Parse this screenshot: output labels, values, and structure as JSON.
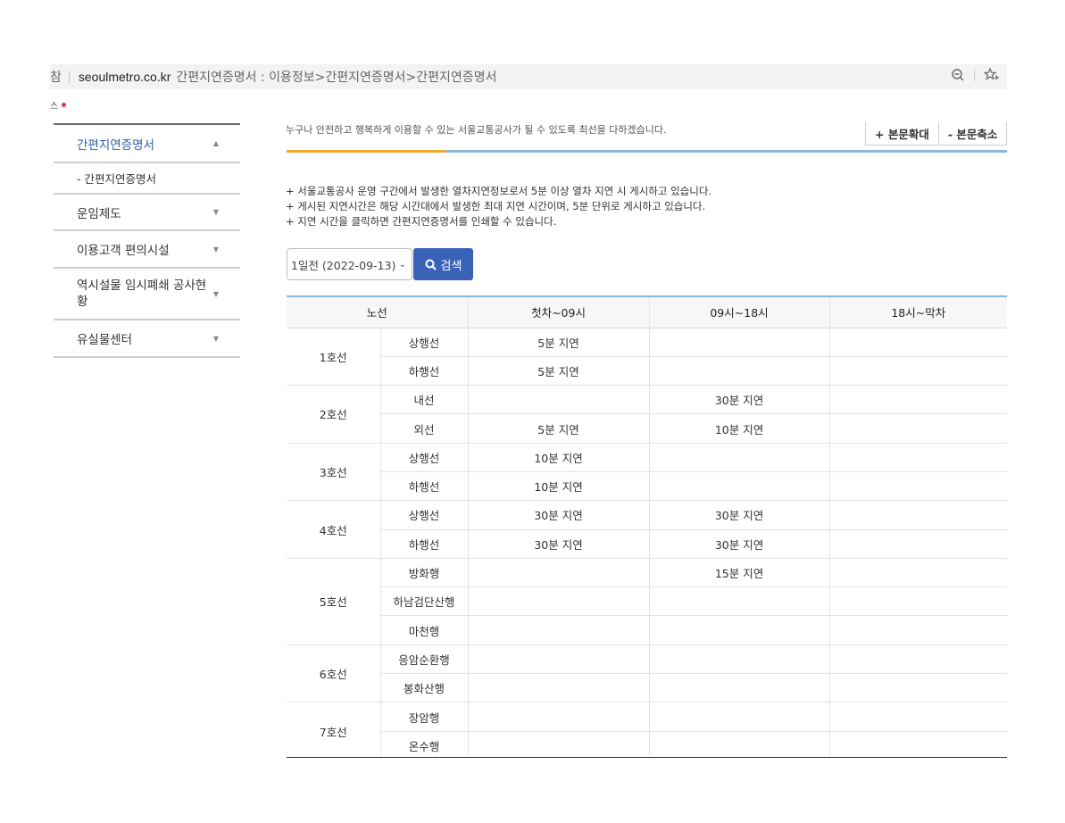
{
  "browser": {
    "left_glyph": "참",
    "domain": "seoulmetro.co.kr",
    "page_title": "간편지연증명서 : 이용정보>간편지연증명서>간편지연증명서",
    "icons": [
      "zoom-out-icon",
      "favorites-star-icon"
    ],
    "bookmark_fragment": "스"
  },
  "sidebar": {
    "active_label": "간편지연증명서",
    "sub_item": "- 간편지연증명서",
    "items": [
      {
        "label": "운임제도"
      },
      {
        "label": "이용고객 편의시설"
      },
      {
        "label": "역시설물 임시폐쇄 공사현황"
      },
      {
        "label": "유실물센터"
      }
    ]
  },
  "main": {
    "intro": "누구나 안전하고 행복하게 이용할 수 있는 서울교통공사가 될 수 있도록 최선을 다하겠습니다.",
    "zoom_in_label": "+ 본문확대",
    "zoom_out_label": "- 본문축소",
    "notes": [
      "+ 서울교통공사 운영 구간에서 발생한 열차지연정보로서 5분 이상 열차 지연 시 게시하고 있습니다.",
      "+ 게시된 지연시간은 해당 시간대에서 발생한 최대 지연 시간이며, 5분 단위로 게시하고 있습니다.",
      "+ 지연 시간을 클릭하면 간편지연증명서를 인쇄할 수 있습니다."
    ],
    "date_select_value": "1일전 (2022-09-13)",
    "search_label": "검색"
  },
  "table": {
    "headers": [
      "노선",
      "첫차~09시",
      "09시~18시",
      "18시~막차"
    ],
    "groups": [
      {
        "line": "1호선",
        "rows": [
          {
            "dir": "상행선",
            "c1": "5분 지연",
            "c2": "",
            "c3": ""
          },
          {
            "dir": "하행선",
            "c1": "5분 지연",
            "c2": "",
            "c3": ""
          }
        ]
      },
      {
        "line": "2호선",
        "rows": [
          {
            "dir": "내선",
            "c1": "",
            "c2": "30분 지연",
            "c3": ""
          },
          {
            "dir": "외선",
            "c1": "5분 지연",
            "c2": "10분 지연",
            "c3": ""
          }
        ]
      },
      {
        "line": "3호선",
        "rows": [
          {
            "dir": "상행선",
            "c1": "10분 지연",
            "c2": "",
            "c3": ""
          },
          {
            "dir": "하행선",
            "c1": "10분 지연",
            "c2": "",
            "c3": ""
          }
        ]
      },
      {
        "line": "4호선",
        "rows": [
          {
            "dir": "상행선",
            "c1": "30분 지연",
            "c2": "30분 지연",
            "c3": ""
          },
          {
            "dir": "하행선",
            "c1": "30분 지연",
            "c2": "30분 지연",
            "c3": ""
          }
        ]
      },
      {
        "line": "5호선",
        "rows": [
          {
            "dir": "방화행",
            "c1": "",
            "c2": "15분 지연",
            "c3": ""
          },
          {
            "dir": "하남검단산행",
            "c1": "",
            "c2": "",
            "c3": ""
          },
          {
            "dir": "마천행",
            "c1": "",
            "c2": "",
            "c3": ""
          }
        ]
      },
      {
        "line": "6호선",
        "rows": [
          {
            "dir": "응암순환행",
            "c1": "",
            "c2": "",
            "c3": ""
          },
          {
            "dir": "봉화산행",
            "c1": "",
            "c2": "",
            "c3": ""
          }
        ]
      },
      {
        "line": "7호선",
        "rows": [
          {
            "dir": "장암행",
            "c1": "",
            "c2": "",
            "c3": ""
          },
          {
            "dir": "온수행",
            "c1": "",
            "c2": "",
            "c3": ""
          }
        ]
      }
    ]
  },
  "colors": {
    "accent_blue": "#3a63b8",
    "active_link": "#2d5fa8",
    "rule_blue": "#8fb7d8",
    "rule_orange": "#f0a830"
  }
}
